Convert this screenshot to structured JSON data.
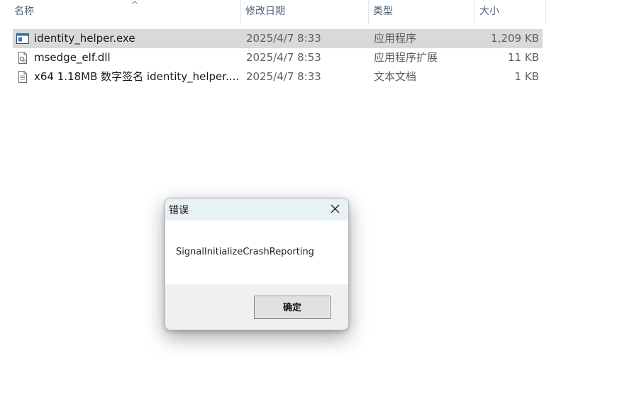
{
  "columns": {
    "name": "名称",
    "modified": "修改日期",
    "type": "类型",
    "size": "大小",
    "sort_indicator": "^"
  },
  "files": [
    {
      "name": "identity_helper.exe",
      "modified": "2025/4/7 8:33",
      "type": "应用程序",
      "size": "1,209 KB",
      "icon": "exe-icon",
      "selected": true
    },
    {
      "name": "msedge_elf.dll",
      "modified": "2025/4/7 8:53",
      "type": "应用程序扩展",
      "size": "11 KB",
      "icon": "dll-icon",
      "selected": false
    },
    {
      "name": "x64 1.18MB 数字签名 identity_helper....",
      "modified": "2025/4/7 8:33",
      "type": "文本文档",
      "size": "1 KB",
      "icon": "text-file-icon",
      "selected": false
    }
  ],
  "dialog": {
    "title": "错误",
    "message": "SignalInitializeCrashReporting",
    "ok_label": "确定",
    "close_icon": "close-icon"
  },
  "colors": {
    "selection": "#d9d9d9",
    "header_text": "#4c607a",
    "dialog_title_bg": "#e8f1f4",
    "dialog_bg": "#f0f0f0"
  }
}
